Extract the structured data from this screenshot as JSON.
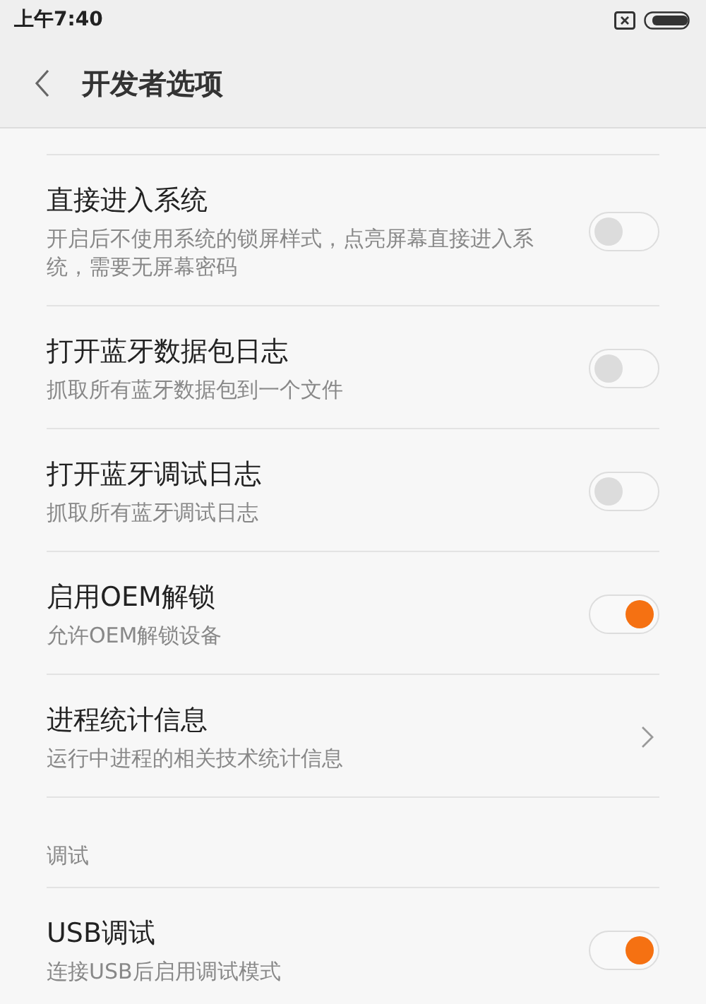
{
  "status_bar": {
    "time": "上午7:40"
  },
  "header": {
    "title": "开发者选项"
  },
  "items": [
    {
      "kind": "toggle",
      "title": "直接进入系统",
      "subtitle": "开启后不使用系统的锁屏样式，点亮屏幕直接进入系统，需要无屏幕密码",
      "on": false
    },
    {
      "kind": "toggle",
      "title": "打开蓝牙数据包日志",
      "subtitle": "抓取所有蓝牙数据包到一个文件",
      "on": false
    },
    {
      "kind": "toggle",
      "title": "打开蓝牙调试日志",
      "subtitle": "抓取所有蓝牙调试日志",
      "on": false
    },
    {
      "kind": "toggle",
      "title": "启用OEM解锁",
      "subtitle": "允许OEM解锁设备",
      "on": true
    },
    {
      "kind": "link",
      "title": "进程统计信息",
      "subtitle": "运行中进程的相关技术统计信息"
    },
    {
      "kind": "section",
      "title": "调试"
    },
    {
      "kind": "toggle",
      "title": "USB调试",
      "subtitle": "连接USB后启用调试模式",
      "on": true
    }
  ]
}
